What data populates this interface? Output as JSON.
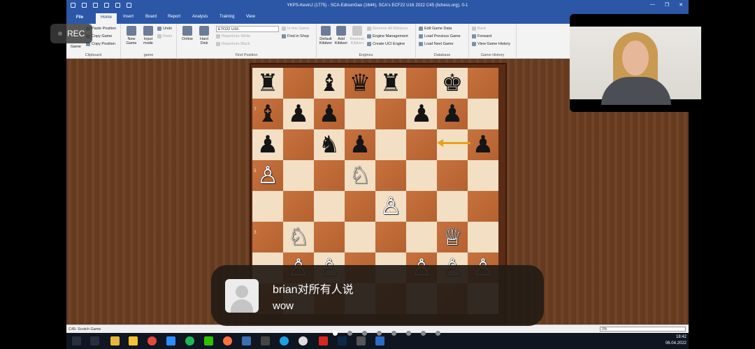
{
  "window": {
    "title": "YKPS-KevinJ (1775) - SCA-EdisonGao (1644), SCA's ECF22 U16 2022  C45  (lichess.org), 0-1",
    "minimize": "—",
    "restore": "❐",
    "close": "✕"
  },
  "ribbon": {
    "tabs": [
      "File",
      "Home",
      "Insert",
      "Board",
      "Report",
      "Analysis",
      "Training",
      "View"
    ],
    "active_tab": "Home",
    "clipboard": {
      "label": "Clipboard",
      "game_btn": "Game",
      "paste_position": "Paste Position",
      "copy_game": "Copy Game",
      "copy_position": "Copy Position"
    },
    "game": {
      "label": "game",
      "new_game": "New Game",
      "input_mode": "Input mode",
      "undo": "Undo",
      "redo": "Redo"
    },
    "find_position": {
      "label": "Find Position",
      "online": "Online",
      "hard_disk": "Hard Disk",
      "combo_value": "ETO22 U16",
      "repertoire_white": "Repertoire White",
      "repertoire_black": "Repertoire Black",
      "in_this_game": "In this Game",
      "find_in_shop": "Find in Shop"
    },
    "engines": {
      "label": "Engines",
      "default_kibitzer": "Default Kibitzer",
      "add_kibitzer": "Add Kibitzer",
      "remove_kibitzer": "Remove Kibitzer",
      "remove_all_kibitzers": "Remove All Kibitzers",
      "engine_management": "Engine Management",
      "create_uci_engine": "Create UCI Engine"
    },
    "database": {
      "label": "Database",
      "edit_game_data": "Edit Game Data",
      "load_previous_game": "Load Previous Game",
      "load_next_game": "Load Next Game"
    },
    "game_history": {
      "label": "Game History",
      "back": "Back",
      "forward": "Forward",
      "view_game_history": "View Game History"
    }
  },
  "board": {
    "ranks": [
      "8",
      "7",
      "6",
      "5",
      "4",
      "3"
    ],
    "squares": [
      [
        "♜",
        "",
        "♝",
        "♛",
        "♜",
        "",
        "♚",
        ""
      ],
      [
        "♝",
        "♟",
        "♟",
        "",
        "",
        "♟",
        "♟",
        ""
      ],
      [
        "♟",
        "",
        "♞",
        "♟",
        "",
        "",
        "",
        "♟"
      ],
      [
        "♙",
        "",
        "",
        "♘",
        "",
        "",
        "",
        ""
      ],
      [
        "",
        "",
        "",
        "",
        "♙",
        "",
        "",
        ""
      ],
      [
        "",
        "♘",
        "",
        "",
        "",
        "",
        "♕",
        ""
      ],
      [
        "",
        "♙",
        "♙",
        "",
        "",
        "♙",
        "♙",
        "♙"
      ],
      [
        "",
        "",
        "",
        "",
        "",
        "",
        "",
        ""
      ]
    ]
  },
  "statusbar": {
    "opening": "C45: Scotch Game",
    "progress": "0%"
  },
  "taskbar": {
    "time": "18:42",
    "date": "06.04.2022"
  },
  "overlay": {
    "rec_label": "REC",
    "toast_sender": "brian对所有人说",
    "toast_message": "wow"
  }
}
